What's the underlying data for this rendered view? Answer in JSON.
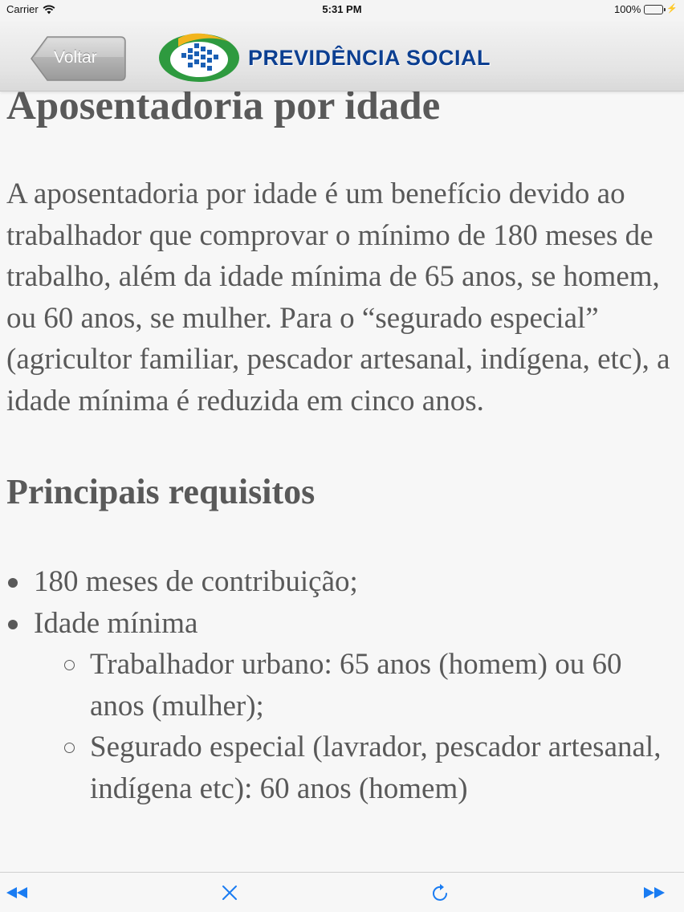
{
  "status_bar": {
    "carrier": "Carrier",
    "time": "5:31 PM",
    "battery": "100%",
    "icons": [
      "wifi-icon",
      "battery-icon",
      "charging-bolt-icon"
    ]
  },
  "header": {
    "back_label": "Voltar",
    "logo_text": "PREVIDÊNCIA SOCIAL",
    "colors": {
      "logo_blue": "#0c3f91",
      "logo_green": "#2e9a3f",
      "logo_yellow": "#f2b51d"
    }
  },
  "article": {
    "title": "Aposentadoria por idade",
    "intro": "A aposentadoria por idade é um benefício devido ao trabalhador que comprovar o mínimo de 180 meses de trabalho, além da idade mínima de 65 anos, se homem, ou 60 anos, se mulher. Para o “segurado especial” (agricultor familiar, pescador artesanal, indígena, etc), a idade mínima é reduzida em cinco anos.",
    "section_title": "Principais requisitos",
    "requirements": [
      {
        "text": "180 meses de contribuição;"
      },
      {
        "text": "Idade mínima"
      }
    ],
    "sub_requirements": [
      {
        "text": "Trabalhador urbano: 65 anos (homem) ou 60 anos (mulher);"
      },
      {
        "text": "Segurado especial (lavrador, pescador artesanal, indígena etc): 60 anos (homem)"
      }
    ]
  },
  "toolbar": {
    "icons": [
      "rewind-icon",
      "close-icon",
      "reload-icon",
      "fast-forward-icon"
    ],
    "accent": "#1a7cf2"
  }
}
